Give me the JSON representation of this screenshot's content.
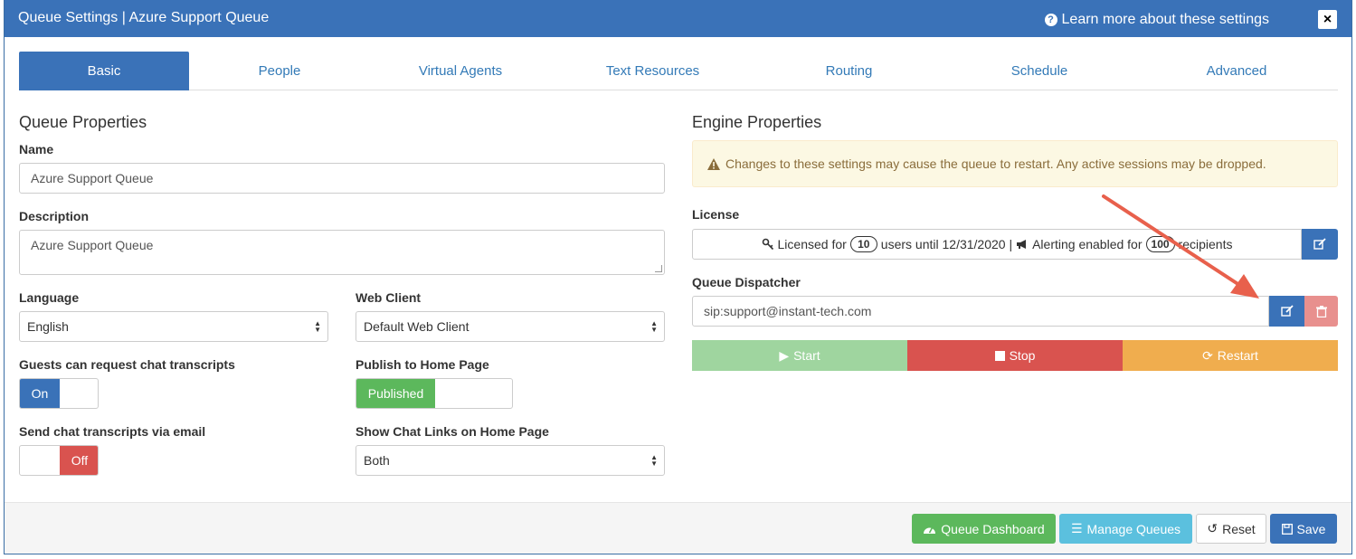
{
  "header": {
    "title": "Queue Settings | Azure Support Queue",
    "learn_more": "Learn more about these settings",
    "close": "×"
  },
  "tabs": [
    {
      "label": "Basic",
      "active": true
    },
    {
      "label": "People"
    },
    {
      "label": "Virtual Agents"
    },
    {
      "label": "Text Resources"
    },
    {
      "label": "Routing"
    },
    {
      "label": "Schedule"
    },
    {
      "label": "Advanced"
    }
  ],
  "queue_properties": {
    "heading": "Queue Properties",
    "name_label": "Name",
    "name_value": "Azure Support Queue",
    "description_label": "Description",
    "description_value": "Azure Support Queue",
    "language_label": "Language",
    "language_value": "English",
    "web_client_label": "Web Client",
    "web_client_value": "Default Web Client",
    "guests_transcripts_label": "Guests can request chat transcripts",
    "guests_transcripts_on": "On",
    "publish_label": "Publish to Home Page",
    "publish_value": "Published",
    "send_email_label": "Send chat transcripts via email",
    "send_email_off": "Off",
    "chat_links_label": "Show Chat Links on Home Page",
    "chat_links_value": "Both"
  },
  "engine_properties": {
    "heading": "Engine Properties",
    "warning": "Changes to these settings may cause the queue to restart. Any active sessions may be dropped.",
    "license_label": "License",
    "license_text_1": "Licensed for",
    "license_users": "10",
    "license_text_2": "users until 12/31/2020 |",
    "license_text_3": "Alerting enabled for",
    "license_recipients": "100",
    "license_text_4": "recipients",
    "dispatcher_label": "Queue Dispatcher",
    "dispatcher_value": "sip:support@instant-tech.com",
    "start": "Start",
    "stop": "Stop",
    "restart": "Restart"
  },
  "footer": {
    "dashboard": "Queue Dashboard",
    "manage": "Manage Queues",
    "reset": "Reset",
    "save": "Save"
  },
  "colors": {
    "primary": "#3a72b8",
    "success": "#5cb85c",
    "info": "#5bc0de",
    "danger": "#d9534f",
    "warning": "#f0ad4e",
    "annotation_arrow": "#e8604c"
  }
}
